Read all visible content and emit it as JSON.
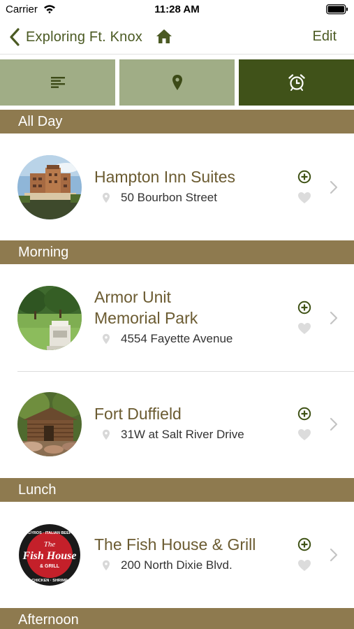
{
  "status_bar": {
    "carrier": "Carrier",
    "time": "11:28 AM"
  },
  "nav": {
    "back_label": "Exploring Ft. Knox",
    "edit_label": "Edit"
  },
  "tabs": [
    {
      "name": "list",
      "icon": "list-icon",
      "selected": false
    },
    {
      "name": "map",
      "icon": "map-pin-icon",
      "selected": false
    },
    {
      "name": "schedule",
      "icon": "alarm-clock-icon",
      "selected": true
    }
  ],
  "sections": [
    {
      "title": "All Day",
      "items": [
        {
          "name": "Hampton Inn Suites",
          "address": "50 Bourbon Street"
        }
      ]
    },
    {
      "title": "Morning",
      "items": [
        {
          "name_lines": [
            "Armor Unit",
            "Memorial Park"
          ],
          "address": "4554 Fayette Avenue"
        },
        {
          "name": "Fort Duffield",
          "address": "31W at Salt River Drive"
        }
      ]
    },
    {
      "title": "Lunch",
      "items": [
        {
          "name": "The Fish House & Grill",
          "address": "200 North Dixie Blvd."
        }
      ]
    },
    {
      "title": "Afternoon"
    }
  ],
  "logo_text": {
    "line1": "The",
    "line2": "Fish House",
    "line3": "& GRILL",
    "top": "GYROS · ITALIAN BEEF",
    "bottom": "CHICKEN · SHRIMP"
  },
  "colors": {
    "accent": "#4b5a23",
    "section_header": "#8e7a4f",
    "tab_unselected": "#a0ad86",
    "tab_selected": "#405219",
    "place_name": "#6b5b31"
  }
}
